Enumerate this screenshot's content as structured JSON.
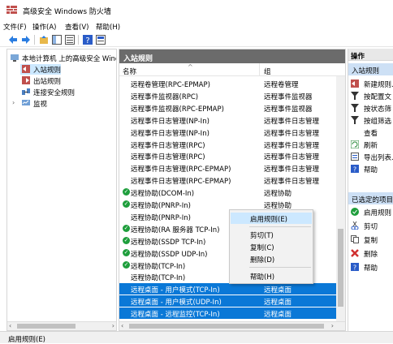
{
  "window": {
    "title": "高级安全 Windows 防火墙"
  },
  "menu": [
    "文件(F)",
    "操作(A)",
    "查看(V)",
    "帮助(H)"
  ],
  "tree": {
    "root": "本地计算机 上的高级安全 Windo",
    "items": [
      "入站规则",
      "出站规则",
      "连接安全规则",
      "监视"
    ]
  },
  "center": {
    "header": "入站规则",
    "columns": {
      "name": "名称",
      "group": "组"
    },
    "rows": [
      {
        "name": "远程卷管理(RPC-EPMAP)",
        "group": "远程卷管理",
        "enabled": false,
        "selected": false
      },
      {
        "name": "远程事件监视器(RPC)",
        "group": "远程事件监视器",
        "enabled": false,
        "selected": false
      },
      {
        "name": "远程事件监视器(RPC-EPMAP)",
        "group": "远程事件监视器",
        "enabled": false,
        "selected": false
      },
      {
        "name": "远程事件日志管理(NP-In)",
        "group": "远程事件日志管理",
        "enabled": false,
        "selected": false
      },
      {
        "name": "远程事件日志管理(NP-In)",
        "group": "远程事件日志管理",
        "enabled": false,
        "selected": false
      },
      {
        "name": "远程事件日志管理(RPC)",
        "group": "远程事件日志管理",
        "enabled": false,
        "selected": false
      },
      {
        "name": "远程事件日志管理(RPC)",
        "group": "远程事件日志管理",
        "enabled": false,
        "selected": false
      },
      {
        "name": "远程事件日志管理(RPC-EPMAP)",
        "group": "远程事件日志管理",
        "enabled": false,
        "selected": false
      },
      {
        "name": "远程事件日志管理(RPC-EPMAP)",
        "group": "远程事件日志管理",
        "enabled": false,
        "selected": false
      },
      {
        "name": "远程协助(DCOM-In)",
        "group": "远程协助",
        "enabled": true,
        "selected": false
      },
      {
        "name": "远程协助(PNRP-In)",
        "group": "远程协助",
        "enabled": true,
        "selected": false
      },
      {
        "name": "远程协助(PNRP-In)",
        "group": "远程协助",
        "enabled": false,
        "selected": false
      },
      {
        "name": "远程协助(RA 服务器 TCP-In)",
        "group": "远程协助",
        "enabled": true,
        "selected": false
      },
      {
        "name": "远程协助(SSDP TCP-In)",
        "group": "远程协助",
        "enabled": true,
        "selected": false
      },
      {
        "name": "远程协助(SSDP UDP-In)",
        "group": "远程协助",
        "enabled": true,
        "selected": false
      },
      {
        "name": "远程协助(TCP-In)",
        "group": "远程协助",
        "enabled": true,
        "selected": false
      },
      {
        "name": "远程协助(TCP-In)",
        "group": "远程协助",
        "enabled": false,
        "selected": false
      },
      {
        "name": "远程桌面 - 用户模式(TCP-In)",
        "group": "远程桌面",
        "enabled": false,
        "selected": true
      },
      {
        "name": "远程桌面 - 用户模式(UDP-In)",
        "group": "远程桌面",
        "enabled": false,
        "selected": true
      },
      {
        "name": "远程桌面 - 远程监控(TCP-In)",
        "group": "远程桌面",
        "enabled": false,
        "selected": true
      }
    ]
  },
  "context_menu": {
    "items": [
      "启用规则(E)",
      "剪切(T)",
      "复制(C)",
      "删除(D)",
      "帮助(H)"
    ]
  },
  "actions": {
    "header": "操作",
    "section1": "入站规则",
    "items1": [
      "新建规则...",
      "按配置文",
      "按状态筛",
      "按组筛选",
      "查看",
      "刷新",
      "导出列表...",
      "帮助"
    ],
    "section2": "已选定的项目",
    "items2": [
      "启用规则",
      "剪切",
      "复制",
      "删除",
      "帮助"
    ]
  },
  "status": {
    "text": "启用规则(E)"
  },
  "colors": {
    "selection": "#0a78d7",
    "header": "#6b6b6b",
    "enabled": "#1e9e3c",
    "context_highlight": "#cce8ff"
  }
}
